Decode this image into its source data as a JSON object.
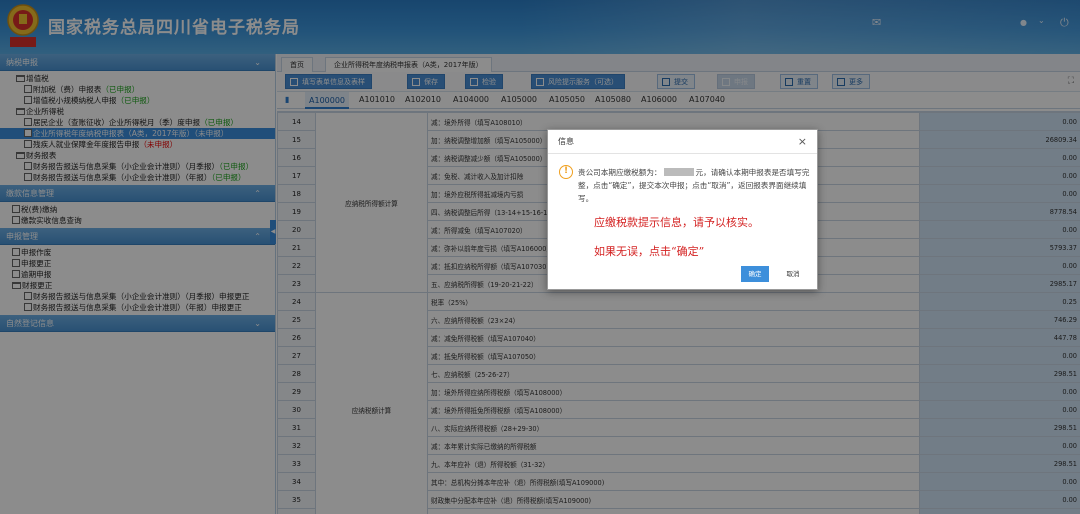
{
  "header": {
    "site_title": "国家税务总局四川省电子税务局",
    "logo_text": "税务"
  },
  "left_panel": {
    "sections": [
      {
        "title": "纳税申报"
      },
      {
        "title": "缴款信息管理"
      },
      {
        "title": "申报管理"
      },
      {
        "title": "自然登记信息"
      }
    ],
    "tree1": [
      {
        "label": "增值税",
        "status": ""
      },
      {
        "label": "附加税（费）申报表",
        "status": "（已申报）"
      },
      {
        "label": "增值税小规模纳税人申报",
        "status": "（已申报）"
      },
      {
        "label": "企业所得税",
        "status": ""
      },
      {
        "label": "居民企业（查账征收）企业所得税月（季）度申报",
        "status": "（已申报）"
      },
      {
        "label": "企业所得税年度纳税申报表（A类，2017年版）",
        "status": "（未申报）"
      },
      {
        "label": "残疾人就业保障金年度报告申报",
        "status": "（未申报）"
      },
      {
        "label": "财务报表",
        "status": ""
      },
      {
        "label": "财务报告报送与信息采集（小企业会计准则）（月季报）",
        "status": "（已申报）"
      },
      {
        "label": "财务报告报送与信息采集（小企业会计准则）（年报）",
        "status": "（已申报）"
      }
    ],
    "tree2": [
      {
        "label": "税(费)缴纳"
      },
      {
        "label": "缴款实收信息查询"
      }
    ],
    "tree3": [
      {
        "label": "申报作废"
      },
      {
        "label": "申报更正"
      },
      {
        "label": "逾期申报"
      },
      {
        "label": "财报更正"
      },
      {
        "label": "财务报告报送与信息采集（小企业会计准则）（月季报）申报更正"
      },
      {
        "label": "财务报告报送与信息采集（小企业会计准则）（年报）申报更正"
      }
    ]
  },
  "tabs": [
    "首页",
    "企业所得税年度纳税申报表（A类，2017年版）"
  ],
  "toolbar": [
    "填写表单信息及表样",
    "保存",
    "检验",
    "风险提示服务（可选）",
    "提交",
    "申报",
    "重置",
    "更多"
  ],
  "sheet_tabs": [
    "A100000",
    "A101010",
    "A102010",
    "A104000",
    "A105000",
    "A105050",
    "A105080",
    "A106000",
    "A107040"
  ],
  "rows": [
    {
      "n": "14",
      "group": "",
      "item": "减：境外所得（填写A108010）",
      "amt": "0.00"
    },
    {
      "n": "15",
      "group": "",
      "item": "加：纳税调整增加额（填写A105000）",
      "amt": "26809.34"
    },
    {
      "n": "16",
      "group": "",
      "item": "减：纳税调整减少额（填写A105000）",
      "amt": "0.00"
    },
    {
      "n": "17",
      "group": "",
      "item": "减：免税、减计收入及加计扣除",
      "amt": "0.00"
    },
    {
      "n": "18",
      "group": "应纳税所得额计算",
      "item": "加：境外应税所得抵减境内亏损",
      "amt": "0.00"
    },
    {
      "n": "19",
      "group": "",
      "item": "四、纳税调整后所得（13-14+15-16-17+18）",
      "amt": "8778.54"
    },
    {
      "n": "20",
      "group": "",
      "item": "减：所得减免（填写A107020）",
      "amt": "0.00"
    },
    {
      "n": "21",
      "group": "",
      "item": "减：弥补以前年度亏损（填写A106000）",
      "amt": "5793.37"
    },
    {
      "n": "22",
      "group": "",
      "item": "减：抵扣应纳税所得额（填写A107030）",
      "amt": "0.00"
    },
    {
      "n": "23",
      "group": "",
      "item": "五、应纳税所得额（19-20-21-22）",
      "amt": "2985.17"
    },
    {
      "n": "24",
      "group": "",
      "item": "税率（25%）",
      "amt": "0.25"
    },
    {
      "n": "25",
      "group": "",
      "item": "六、应纳所得税额（23×24）",
      "amt": "746.29"
    },
    {
      "n": "26",
      "group": "",
      "item": "减：减免所得税额（填写A107040）",
      "amt": "447.78"
    },
    {
      "n": "27",
      "group": "",
      "item": "减：抵免所得税额（填写A107050）",
      "amt": "0.00"
    },
    {
      "n": "28",
      "group": "",
      "item": "七、应纳税额（25-26-27）",
      "amt": "298.51"
    },
    {
      "n": "29",
      "group": "应纳税额计算",
      "item": "加：境外所得应纳所得税额（填写A108000）",
      "amt": "0.00"
    },
    {
      "n": "30",
      "group": "",
      "item": "减：境外所得抵免所得税额（填写A108000）",
      "amt": "0.00"
    },
    {
      "n": "31",
      "group": "",
      "item": "八、实际应纳所得税额（28+29-30）",
      "amt": "298.51"
    },
    {
      "n": "32",
      "group": "",
      "item": "减：本年累计实际已缴纳的所得税额",
      "amt": "0.00"
    },
    {
      "n": "33",
      "group": "",
      "item": "九、本年应补（退）所得税额（31-32）",
      "amt": "298.51"
    },
    {
      "n": "34",
      "group": "",
      "item": "其中：总机构分摊本年应补（退）所得税额(填写A109000)",
      "amt": "0.00"
    },
    {
      "n": "35",
      "group": "",
      "item": "财政集中分配本年应补（退）所得税额(填写A109000)",
      "amt": "0.00"
    },
    {
      "n": "36",
      "group": "",
      "item": "总机构主体生产经营部门分摊本年应补（退）所得税额(填写A109000)",
      "amt": "0.00"
    }
  ],
  "dialog": {
    "title": "信息",
    "msg_part1": "贵公司本期应缴税额为：",
    "msg_part2": "元，请确认本期申报表是否填写完整，点击“确定”，提交本次申报；点击“取消”，返回报表界面继续填写。",
    "hint1": "应缴税款提示信息，请予以核实。",
    "hint2": "如果无误，点击“确定”",
    "ok": "确定",
    "cancel": "取消"
  }
}
